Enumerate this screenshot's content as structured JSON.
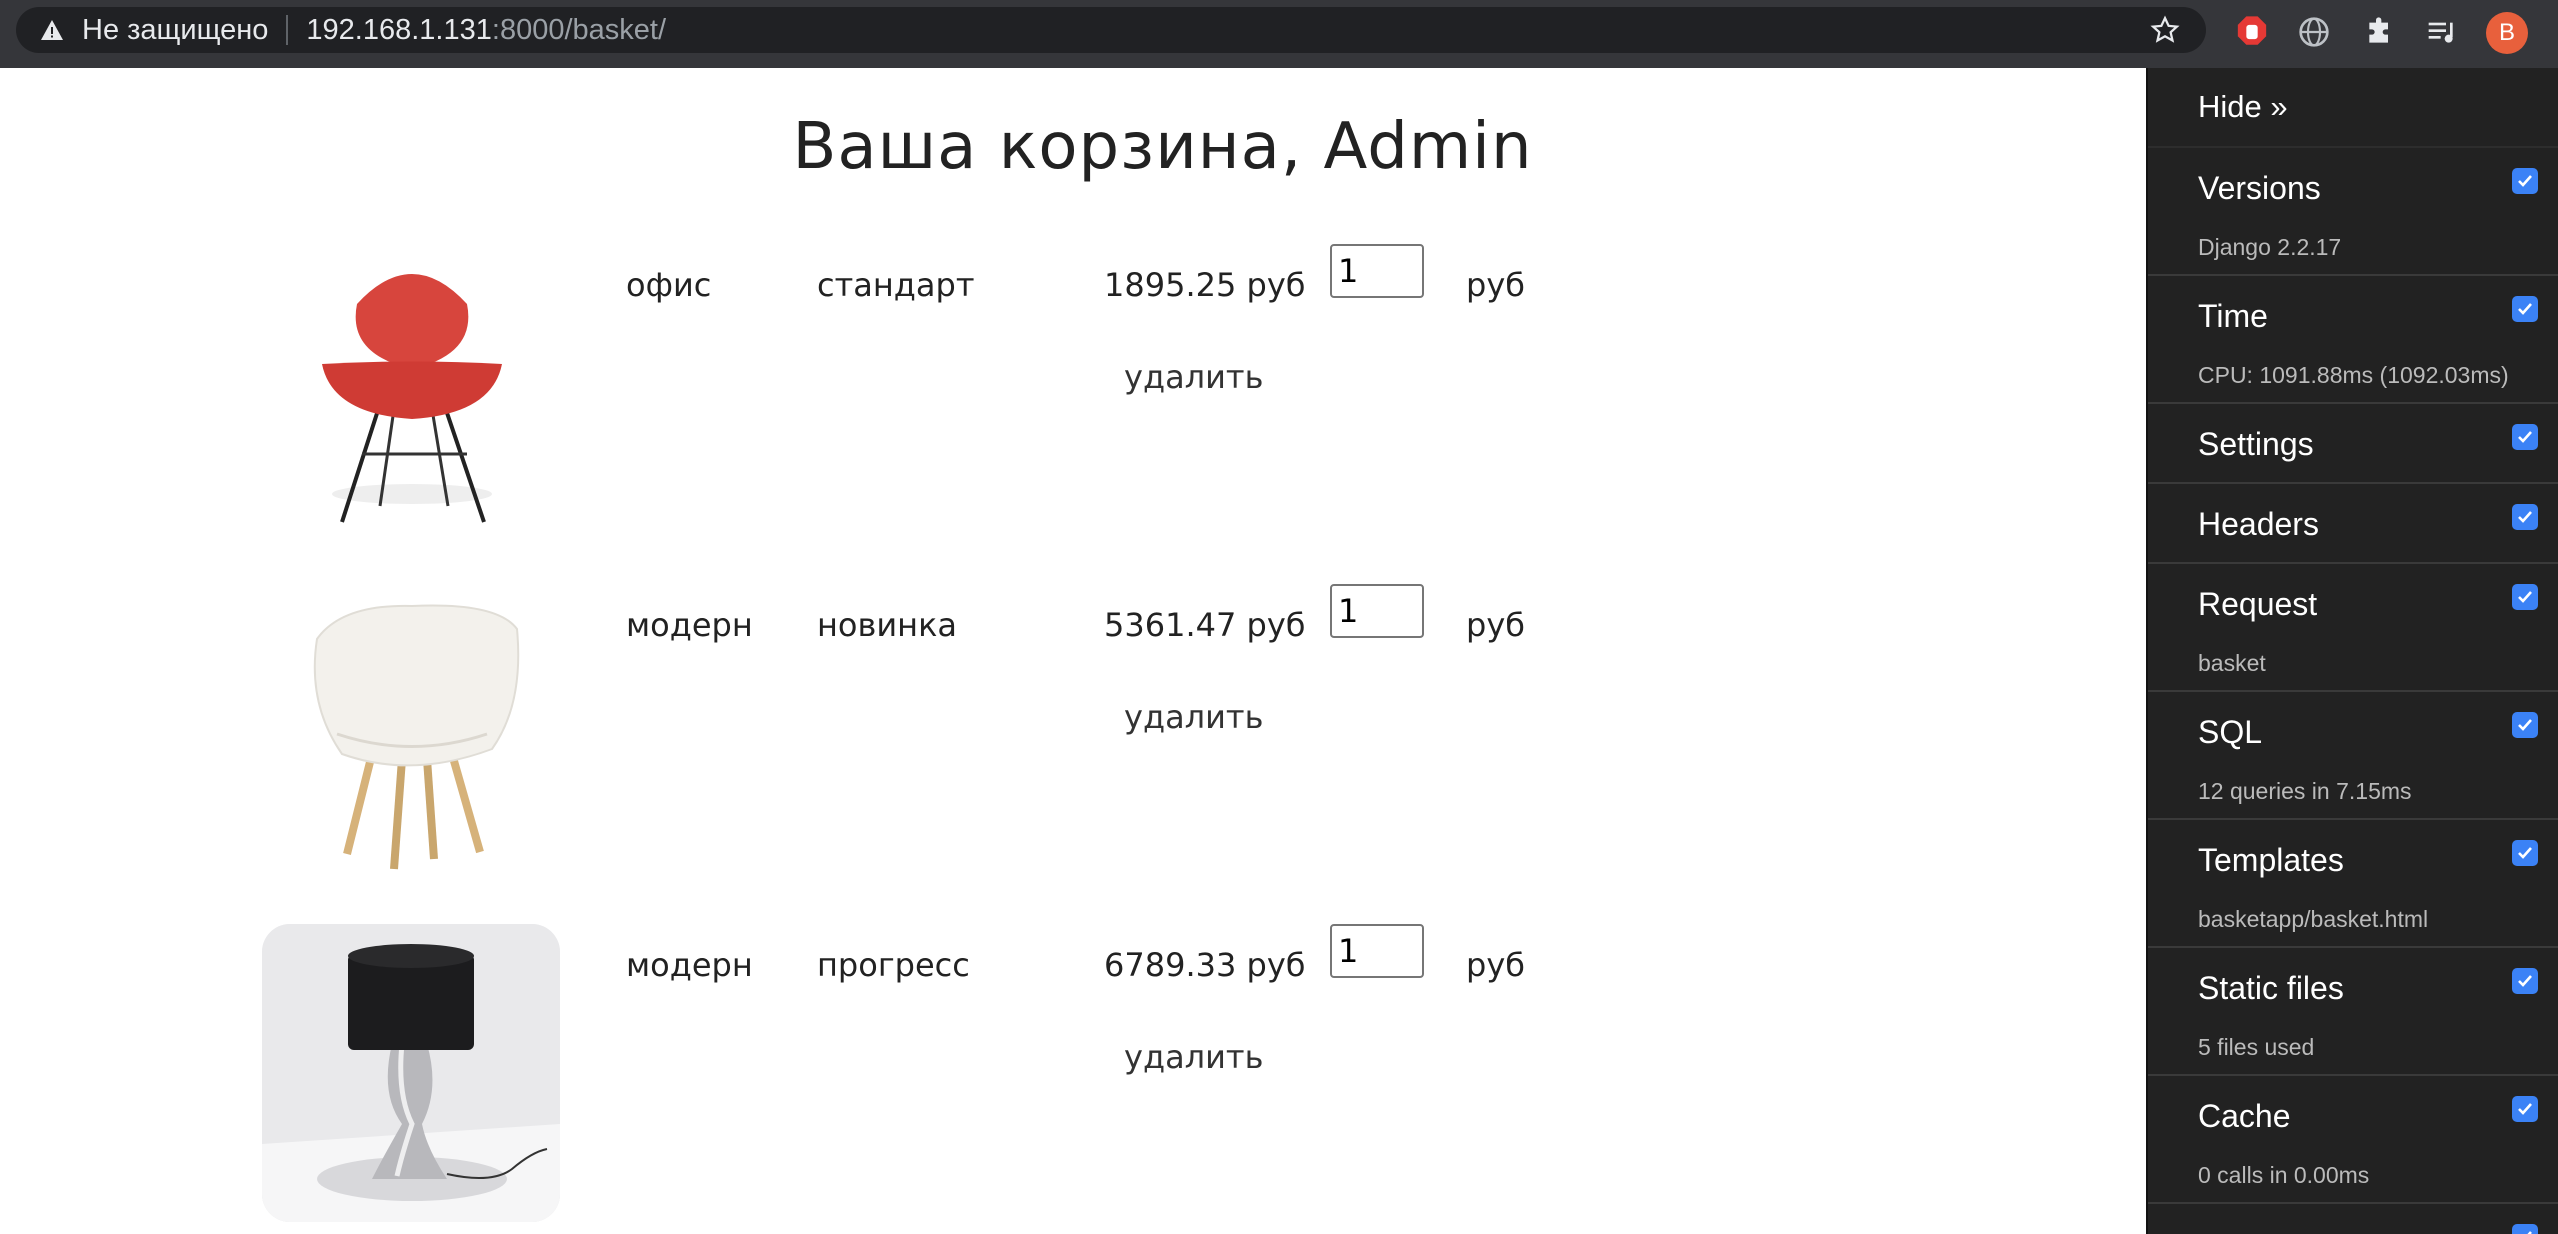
{
  "browser": {
    "security_label": "Не защищено",
    "url_host": "192.168.1.131",
    "url_rest": ":8000/basket/",
    "profile_initial": "B"
  },
  "page": {
    "title": "Ваша корзина, Admin"
  },
  "basket": {
    "items": [
      {
        "category": "офис",
        "name": "стандарт",
        "price": "1895.25 руб",
        "quantity": "1",
        "unit": "руб",
        "delete_label": "удалить",
        "image": "red-chair-image"
      },
      {
        "category": "модерн",
        "name": "новинка",
        "price": "5361.47 руб",
        "quantity": "1",
        "unit": "руб",
        "delete_label": "удалить",
        "image": "white-chair-image"
      },
      {
        "category": "модерн",
        "name": "прогресс",
        "price": "6789.33 руб",
        "quantity": "1",
        "unit": "руб",
        "delete_label": "удалить",
        "image": "table-lamp-image"
      }
    ]
  },
  "debug_toolbar": {
    "hide_label": "Hide »",
    "panels": [
      {
        "title": "Versions",
        "subtitle": "Django 2.2.17"
      },
      {
        "title": "Time",
        "subtitle": "CPU: 1091.88ms (1092.03ms)"
      },
      {
        "title": "Settings",
        "subtitle": ""
      },
      {
        "title": "Headers",
        "subtitle": ""
      },
      {
        "title": "Request",
        "subtitle": "basket"
      },
      {
        "title": "SQL",
        "subtitle": "12 queries in 7.15ms"
      },
      {
        "title": "Templates",
        "subtitle": "basketapp/basket.html"
      },
      {
        "title": "Static files",
        "subtitle": "5 files used"
      },
      {
        "title": "Cache",
        "subtitle": "0 calls in 0.00ms"
      }
    ],
    "checkbox_color": "#3b82f6"
  }
}
